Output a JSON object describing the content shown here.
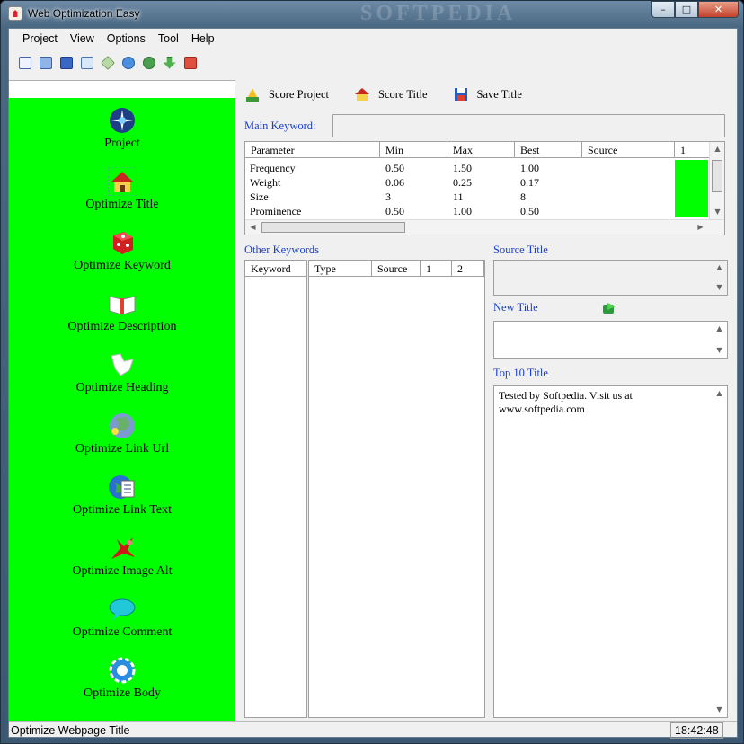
{
  "window": {
    "title": "Web Optimization Easy",
    "watermark": "SOFTPEDIA"
  },
  "menu": [
    "Project",
    "View",
    "Options",
    "Tool",
    "Help"
  ],
  "toolbar": [
    "new-icon",
    "open-icon",
    "save-icon",
    "refresh-icon",
    "edit-icon",
    "browser-icon",
    "help-icon",
    "download-icon",
    "power-icon"
  ],
  "sidebar": [
    {
      "label": "Project",
      "icon": "project-icon"
    },
    {
      "label": "Optimize Title",
      "icon": "house-icon"
    },
    {
      "label": "Optimize Keyword",
      "icon": "die-icon"
    },
    {
      "label": "Optimize Description",
      "icon": "book-icon"
    },
    {
      "label": "Optimize Heading",
      "icon": "heading-icon"
    },
    {
      "label": "Optimize Link Url",
      "icon": "globe-icon"
    },
    {
      "label": "Optimize Link Text",
      "icon": "link-text-icon"
    },
    {
      "label": "Optimize Image Alt",
      "icon": "image-alt-icon"
    },
    {
      "label": "Optimize Comment",
      "icon": "comment-icon"
    },
    {
      "label": "Optimize Body",
      "icon": "gear-icon"
    }
  ],
  "actions": {
    "score_project": "Score Project",
    "score_title": "Score Title",
    "save_title": "Save Title"
  },
  "main_keyword": {
    "label": "Main Keyword:",
    "value": ""
  },
  "parameters": {
    "columns": [
      "Parameter",
      "Min",
      "Max",
      "Best",
      "Source",
      "1"
    ],
    "rows": [
      [
        "Frequency",
        "0.50",
        "1.50",
        "1.00",
        "",
        ""
      ],
      [
        "Weight",
        "0.06",
        "0.25",
        "0.17",
        "",
        ""
      ],
      [
        "Size",
        "3",
        "11",
        "8",
        "",
        ""
      ],
      [
        "Prominence",
        "0.50",
        "1.00",
        "0.50",
        "",
        ""
      ]
    ],
    "highlight_color": "#00ff00"
  },
  "other_keywords": {
    "label": "Other Keywords",
    "columns_left": [
      "Keyword"
    ],
    "columns_right": [
      "Type",
      "Source",
      "1",
      "2"
    ]
  },
  "source_title": {
    "label": "Source Title",
    "value": ""
  },
  "new_title": {
    "label": "New Title",
    "value": ""
  },
  "top10": {
    "label": "Top 10 Title",
    "value": "Tested by Softpedia. Visit us at www.softpedia.com"
  },
  "status": {
    "text": "Optimize Webpage Title",
    "time": "18:42:48"
  },
  "colors": {
    "sidebar_bg": "#00ff00",
    "link_blue": "#1a3fd0"
  }
}
